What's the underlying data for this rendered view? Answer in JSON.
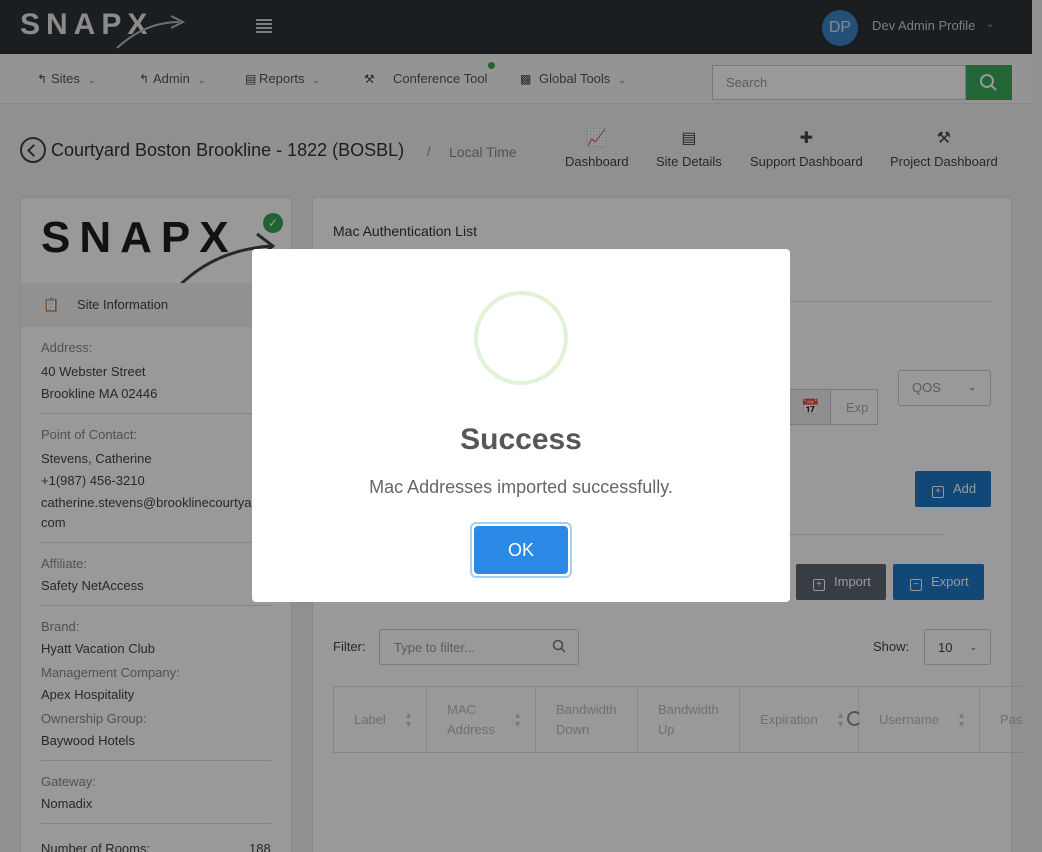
{
  "header": {
    "logo": "SNAPX",
    "profile": {
      "initials": "DP",
      "name": "Dev Admin Profile"
    }
  },
  "nav": {
    "items": [
      {
        "label": "Sites",
        "icon": "sitemap-icon"
      },
      {
        "label": "Admin",
        "icon": "sitemap-icon"
      },
      {
        "label": "Reports",
        "icon": "area-chart-icon"
      },
      {
        "label": "Conference Tool",
        "icon": "hammer-icon"
      },
      {
        "label": "Global Tools",
        "icon": "briefcase-icon"
      }
    ],
    "search_placeholder": "Search",
    "accent": "#39a85c"
  },
  "page": {
    "title": "Courtyard Boston Brookline - 1822 (BOSBL)",
    "separator": "/",
    "local_time_label": "Local Time",
    "quick_links": [
      {
        "label": "Dashboard",
        "icon": "line-chart-icon"
      },
      {
        "label": "Site Details",
        "icon": "document-icon"
      },
      {
        "label": "Support Dashboard",
        "icon": "medkit-icon"
      },
      {
        "label": "Project Dashboard",
        "icon": "hammer-icon"
      }
    ]
  },
  "site_panel": {
    "logo": "SNAPX",
    "section_label": "Site Information",
    "address_label": "Address:",
    "address_line1": "40 Webster Street",
    "address_line2": "Brookline MA 02446",
    "contact_label": "Point of Contact:",
    "contact_name": "Stevens, Catherine",
    "contact_phone": "+1(987) 456-3210",
    "contact_email_line1": "catherine.stevens@brooklinecourtya",
    "contact_email_line2": "com",
    "affiliate_label": "Affiliate:",
    "affiliate": "Safety NetAccess",
    "brand_label": "Brand:",
    "brand": "Hyatt Vacation Club",
    "mgmt_label": "Management Company:",
    "mgmt": "Apex Hospitality",
    "ownership_label": "Ownership Group:",
    "ownership": "Baywood Hotels",
    "gateway_label": "Gateway:",
    "gateway": "Nomadix",
    "rooms_label": "Number of Rooms:",
    "rooms": "188"
  },
  "mac_panel": {
    "title": "Mac Authentication List",
    "qos_label": "QOS",
    "expiration_placeholder": "Exp",
    "add_label": "Add",
    "import_label": "Import",
    "export_label": "Export",
    "filter_label": "Filter:",
    "filter_placeholder": "Type to filter...",
    "show_label": "Show:",
    "show_value": "10",
    "columns": [
      "Label",
      "MAC Address",
      "Bandwidth Down",
      "Bandwidth Up",
      "Expiration",
      "Username",
      "Pas"
    ]
  },
  "modal": {
    "title": "Success",
    "message": "Mac Addresses imported successfully.",
    "ok_label": "OK",
    "button_color": "#2b8ae6"
  }
}
